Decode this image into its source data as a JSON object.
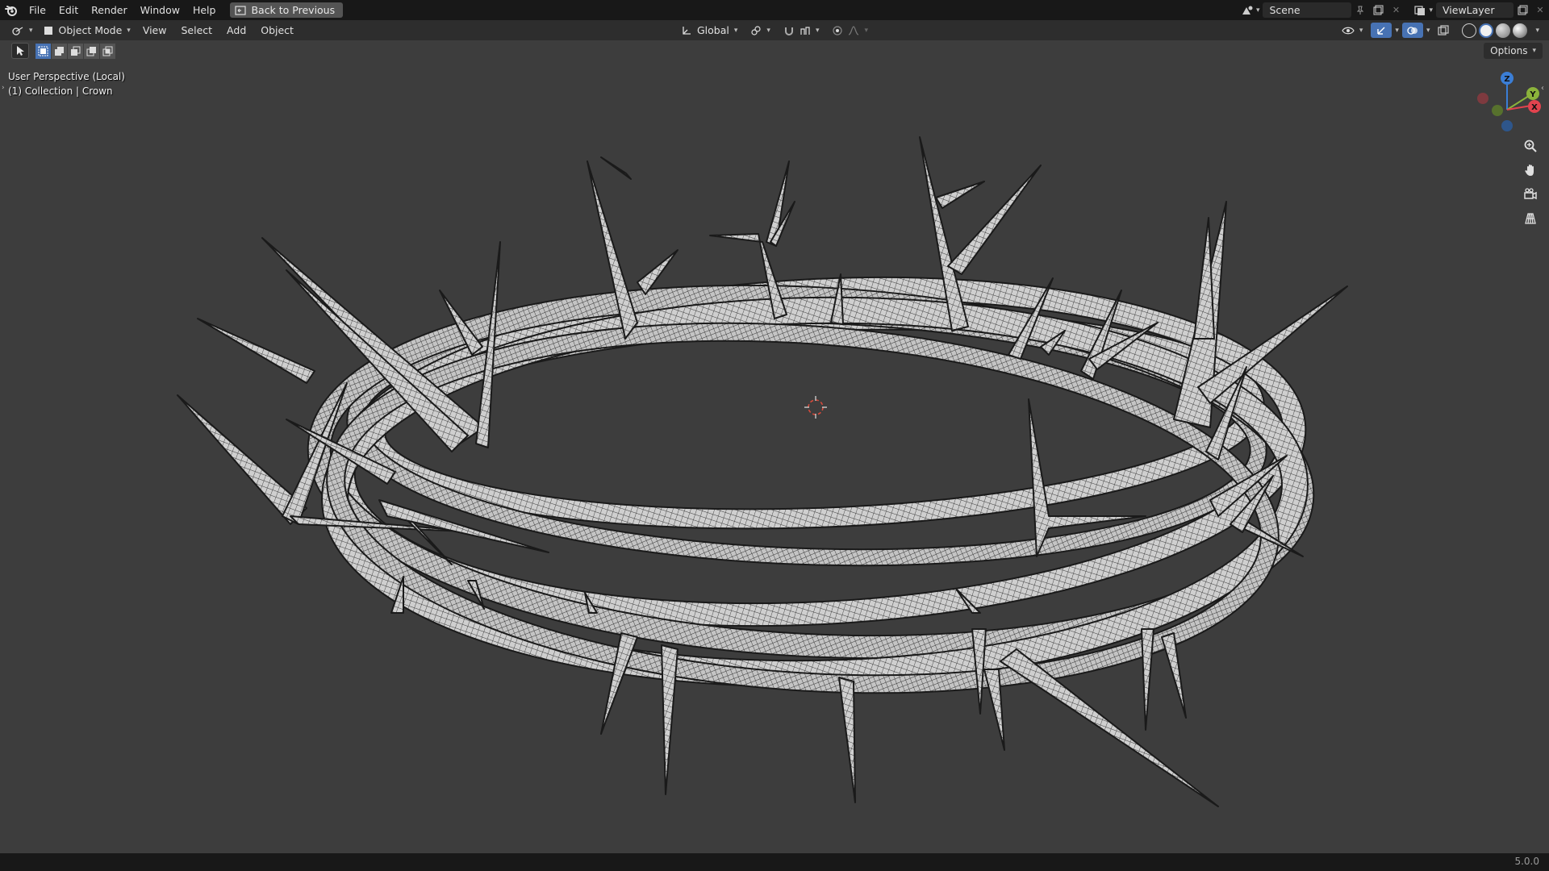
{
  "topbar": {
    "menu": [
      "File",
      "Edit",
      "Render",
      "Window",
      "Help"
    ],
    "back_label": "Back to Previous",
    "scene_label": "Scene",
    "viewlayer_label": "ViewLayer"
  },
  "viewport_header": {
    "mode_label": "Object Mode",
    "menus": [
      "View",
      "Select",
      "Add",
      "Object"
    ],
    "orientation_label": "Global"
  },
  "toolrow": {
    "options_label": "Options"
  },
  "viewport": {
    "perspective_label": "User Perspective (Local)",
    "collection_label": "(1) Collection | Crown"
  },
  "gizmo": {
    "axis_z": "Z",
    "axis_y": "Y",
    "axis_x": "X"
  },
  "status": {
    "version": "5.0.0"
  },
  "colors": {
    "accent": "#4772b3",
    "axis_x": "#e2434e",
    "axis_y": "#8bb33b",
    "axis_z": "#3b7ed6",
    "cursor": "#d64a3b"
  }
}
